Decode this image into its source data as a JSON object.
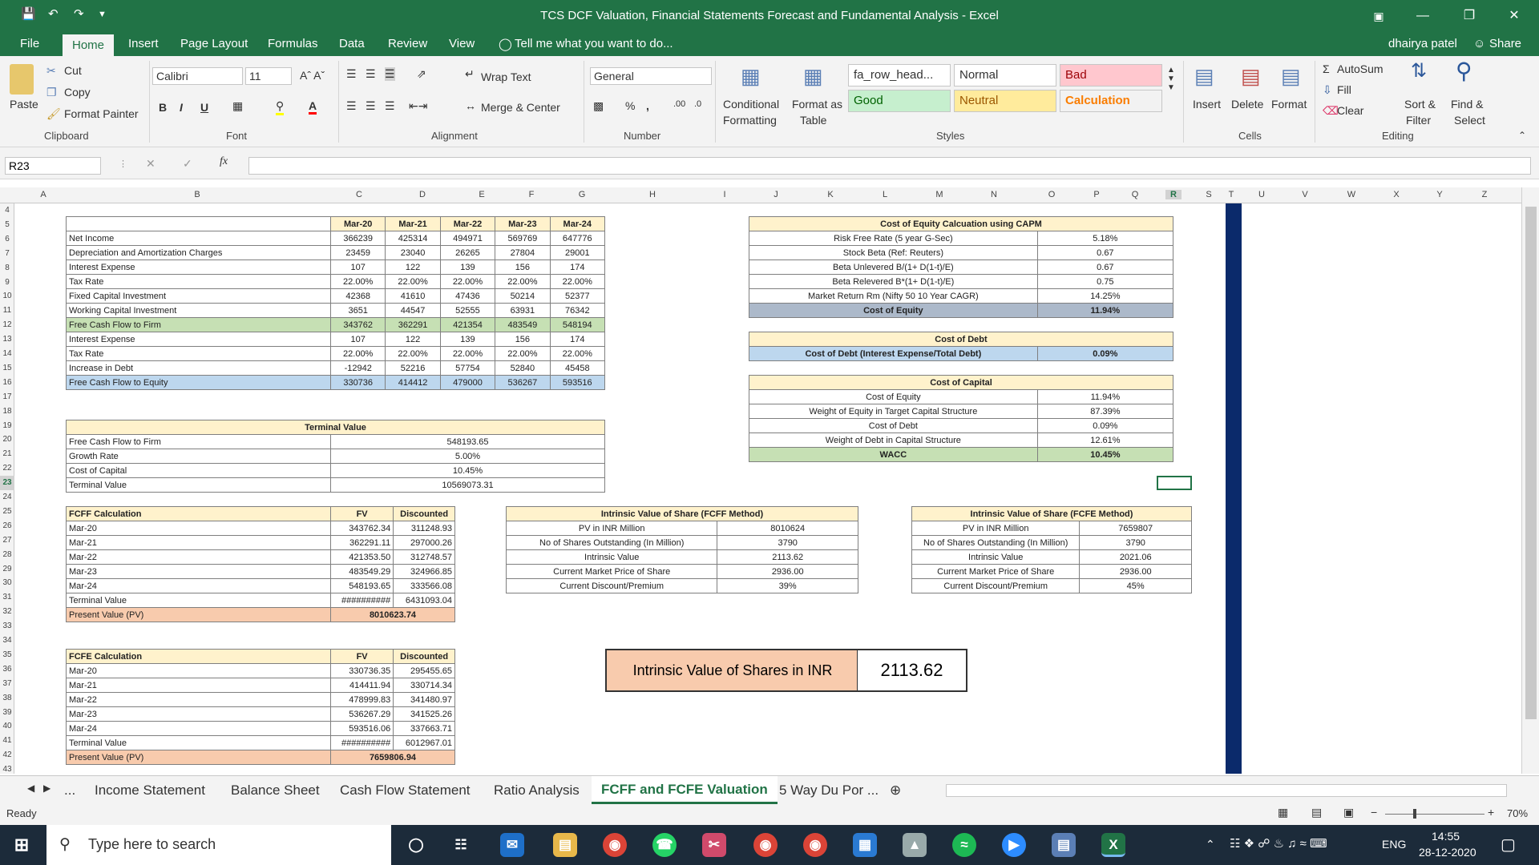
{
  "app": {
    "title": "TCS DCF Valuation, Financial Statements Forecast and Fundamental Analysis - Excel",
    "user": "dhairya patel",
    "share": "Share"
  },
  "menu": [
    "File",
    "Home",
    "Insert",
    "Page Layout",
    "Formulas",
    "Data",
    "Review",
    "View"
  ],
  "tell_me": "Tell me what you want to do...",
  "ribbon": {
    "clipboard": {
      "paste": "Paste",
      "cut": "Cut",
      "copy": "Copy",
      "format_painter": "Format Painter",
      "label": "Clipboard"
    },
    "font": {
      "name": "Calibri",
      "size": "11",
      "label": "Font"
    },
    "alignment": {
      "wrap": "Wrap Text",
      "merge": "Merge & Center",
      "label": "Alignment"
    },
    "number": {
      "format": "General",
      "label": "Number"
    },
    "styles": {
      "cond": "Conditional",
      "cond2": "Formatting",
      "fmt_table": "Format as",
      "fmt_table2": "Table",
      "cells": [
        "fa_row_head...",
        "Normal",
        "Bad",
        "Good",
        "Neutral",
        "Calculation"
      ],
      "label": "Styles"
    },
    "cells": {
      "insert": "Insert",
      "delete": "Delete",
      "format": "Format",
      "label": "Cells"
    },
    "editing": {
      "autosum": "AutoSum",
      "fill": "Fill",
      "clear": "Clear",
      "sort": "Sort &",
      "sort2": "Filter",
      "find": "Find &",
      "find2": "Select",
      "label": "Editing"
    },
    "colors": {
      "bad": "#ffc7ce",
      "good": "#c6efce",
      "neutral": "#ffeb9c",
      "calc": "#f2f2f2"
    }
  },
  "formula": {
    "namebox": "R23",
    "value": ""
  },
  "columns": [
    "A",
    "B",
    "C",
    "D",
    "E",
    "F",
    "G",
    "H",
    "I",
    "J",
    "K",
    "L",
    "M",
    "N",
    "O",
    "P",
    "Q",
    "R",
    "S",
    "T",
    "U",
    "V",
    "W",
    "X",
    "Y",
    "Z"
  ],
  "rows": [
    "4",
    "5",
    "6",
    "7",
    "8",
    "9",
    "10",
    "11",
    "12",
    "13",
    "14",
    "15",
    "16",
    "17",
    "18",
    "19",
    "20",
    "21",
    "22",
    "23",
    "24",
    "25",
    "26",
    "27",
    "28",
    "29",
    "30",
    "31",
    "32",
    "33",
    "34",
    "35",
    "36",
    "37",
    "38",
    "39",
    "40",
    "41",
    "42",
    "43"
  ],
  "fcf": {
    "headers": [
      "",
      "Mar-20",
      "Mar-21",
      "Mar-22",
      "Mar-23",
      "Mar-24"
    ],
    "rows": [
      [
        "Net Income",
        "366239",
        "425314",
        "494971",
        "569769",
        "647776"
      ],
      [
        "Depreciation and Amortization Charges",
        "23459",
        "23040",
        "26265",
        "27804",
        "29001"
      ],
      [
        "Interest Expense",
        "107",
        "122",
        "139",
        "156",
        "174"
      ],
      [
        "Tax Rate",
        "22.00%",
        "22.00%",
        "22.00%",
        "22.00%",
        "22.00%"
      ],
      [
        "Fixed Capital Investment",
        "42368",
        "41610",
        "47436",
        "50214",
        "52377"
      ],
      [
        "Working Capital Investment",
        "3651",
        "44547",
        "52555",
        "63931",
        "76342"
      ],
      [
        "Free Cash Flow to Firm",
        "343762",
        "362291",
        "421354",
        "483549",
        "548194"
      ],
      [
        "Interest Expense",
        "107",
        "122",
        "139",
        "156",
        "174"
      ],
      [
        "Tax Rate",
        "22.00%",
        "22.00%",
        "22.00%",
        "22.00%",
        "22.00%"
      ],
      [
        "Increase in Debt",
        "-12942",
        "52216",
        "57754",
        "52840",
        "45458"
      ],
      [
        "Free Cash Flow to Equity",
        "330736",
        "414412",
        "479000",
        "536267",
        "593516"
      ]
    ]
  },
  "terminal": {
    "title": "Terminal Value",
    "rows": [
      [
        "Free Cash Flow to Firm",
        "548193.65"
      ],
      [
        "Growth Rate",
        "5.00%"
      ],
      [
        "Cost of Capital",
        "10.45%"
      ],
      [
        "Terminal Value",
        "10569073.31"
      ]
    ]
  },
  "fcff": {
    "headers": [
      "FCFF Calculation",
      "FV",
      "Discounted"
    ],
    "rows": [
      [
        "Mar-20",
        "343762.34",
        "311248.93"
      ],
      [
        "Mar-21",
        "362291.11",
        "297000.26"
      ],
      [
        "Mar-22",
        "421353.50",
        "312748.57"
      ],
      [
        "Mar-23",
        "483549.29",
        "324966.85"
      ],
      [
        "Mar-24",
        "548193.65",
        "333566.08"
      ],
      [
        "Terminal Value",
        "##########",
        "6431093.04"
      ]
    ],
    "pv_label": "Present Value (PV)",
    "pv": "8010623.74"
  },
  "fcfe": {
    "headers": [
      "FCFE Calculation",
      "FV",
      "Discounted"
    ],
    "rows": [
      [
        "Mar-20",
        "330736.35",
        "295455.65"
      ],
      [
        "Mar-21",
        "414411.94",
        "330714.34"
      ],
      [
        "Mar-22",
        "478999.83",
        "341480.97"
      ],
      [
        "Mar-23",
        "536267.29",
        "341525.26"
      ],
      [
        "Mar-24",
        "593516.06",
        "337663.71"
      ],
      [
        "Terminal Value",
        "##########",
        "6012967.01"
      ]
    ],
    "pv_label": "Present Value (PV)",
    "pv": "7659806.94"
  },
  "capm": {
    "title": "Cost of Equity Calcuation using CAPM",
    "rows": [
      [
        "Risk Free Rate (5 year G-Sec)",
        "5.18%"
      ],
      [
        "Stock Beta (Ref: Reuters)",
        "0.67"
      ],
      [
        "Beta Unlevered B/(1+ D(1-t)/E)",
        "0.67"
      ],
      [
        "Beta Relevered B*(1+ D(1-t)/E)",
        "0.75"
      ],
      [
        "Market Return Rm (Nifty 50 10 Year CAGR)",
        "14.25%"
      ],
      [
        "Cost of Equity",
        "11.94%"
      ]
    ]
  },
  "debt": {
    "title": "Cost of Debt",
    "rows": [
      [
        "Cost of Debt (Interest Expense/Total Debt)",
        "0.09%"
      ]
    ]
  },
  "capital": {
    "title": "Cost of Capital",
    "rows": [
      [
        "Cost of Equity",
        "11.94%"
      ],
      [
        "Weight of Equity in Target Capital Structure",
        "87.39%"
      ],
      [
        "Cost of Debt",
        "0.09%"
      ],
      [
        "Weight of Debt in Capital Structure",
        "12.61%"
      ],
      [
        "WACC",
        "10.45%"
      ]
    ]
  },
  "iv_fcff": {
    "title": "Intrinsic Value of Share (FCFF Method)",
    "rows": [
      [
        "PV in INR Million",
        "8010624"
      ],
      [
        "No of Shares Outstanding (In Million)",
        "3790"
      ],
      [
        "Intrinsic Value",
        "2113.62"
      ],
      [
        "Current Market Price of Share",
        "2936.00"
      ],
      [
        "Current Discount/Premium",
        "39%"
      ]
    ]
  },
  "iv_fcfe": {
    "title": "Intrinsic Value of Share (FCFE Method)",
    "rows": [
      [
        "PV in INR Million",
        "7659807"
      ],
      [
        "No of Shares Outstanding (In Million)",
        "3790"
      ],
      [
        "Intrinsic Value",
        "2021.06"
      ],
      [
        "Current Market Price of Share",
        "2936.00"
      ],
      [
        "Current Discount/Premium",
        "45%"
      ]
    ]
  },
  "summary": {
    "label": "Intrinsic Value of Shares in INR",
    "value": "2113.62"
  },
  "sheets": [
    "Income Statement",
    "Balance Sheet",
    "Cash Flow Statement",
    "Ratio Analysis",
    "FCFF and FCFE Valuation",
    "5 Way Du Por ..."
  ],
  "status": {
    "ready": "Ready",
    "zoom": "70%"
  },
  "taskbar": {
    "search": "Type here to search",
    "lang": "ENG",
    "time": "14:55",
    "date": "28-12-2020"
  }
}
